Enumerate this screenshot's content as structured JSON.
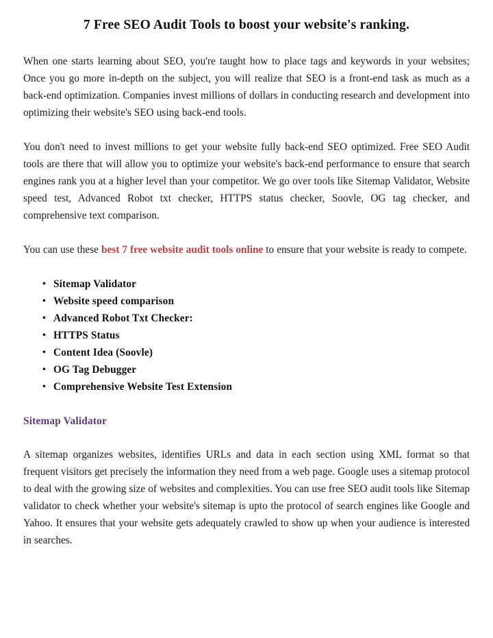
{
  "document": {
    "title": "7 Free SEO Audit Tools to boost your website's ranking.",
    "colors": {
      "background": "#ffffff",
      "body_text": "#1a1a1a",
      "accent_red": "#bf4040",
      "heading_purple": "#5b3a7e"
    }
  },
  "paragraphs": {
    "intro": "When one starts learning about SEO, you're taught how to place tags and keywords in your websites; Once you go more in-depth on the subject, you will realize that SEO is a front-end task as much as a back-end optimization. Companies invest millions of dollars in conducting research and development into optimizing their website's SEO using back-end tools.",
    "second": "You don't need to invest millions to get your website fully back-end SEO optimized. Free SEO Audit tools are there that will allow you to optimize your website's back-end performance to ensure that search engines rank you at a higher level than your competitor. We go over tools like Sitemap Validator, Website speed test, Advanced Robot txt checker, HTTPS status checker, Soovle, OG tag checker, and comprehensive text comparison.",
    "cta_before": "You can use these ",
    "cta_highlight": "best 7 free website audit tools online",
    "cta_after": " to ensure that your website is ready to compete.",
    "sitemap_body": "A sitemap organizes websites, identifies URLs and data in each section using XML format so that frequent visitors get precisely the information they need from a web page. Google uses a sitemap protocol to deal with the growing size of websites and complexities. You can use free SEO audit tools like Sitemap validator to check whether your website's sitemap is upto the protocol of search engines like Google and Yahoo. It ensures that your website gets adequately crawled to show up when your audience is interested in searches."
  },
  "tool_list": [
    "Sitemap Validator",
    "Website speed comparison",
    "Advanced Robot Txt Checker:",
    "HTTPS Status",
    "Content Idea (Soovle)",
    "OG Tag Debugger",
    "Comprehensive Website Test Extension"
  ],
  "sections": {
    "sitemap_validator_heading": "Sitemap Validator"
  }
}
